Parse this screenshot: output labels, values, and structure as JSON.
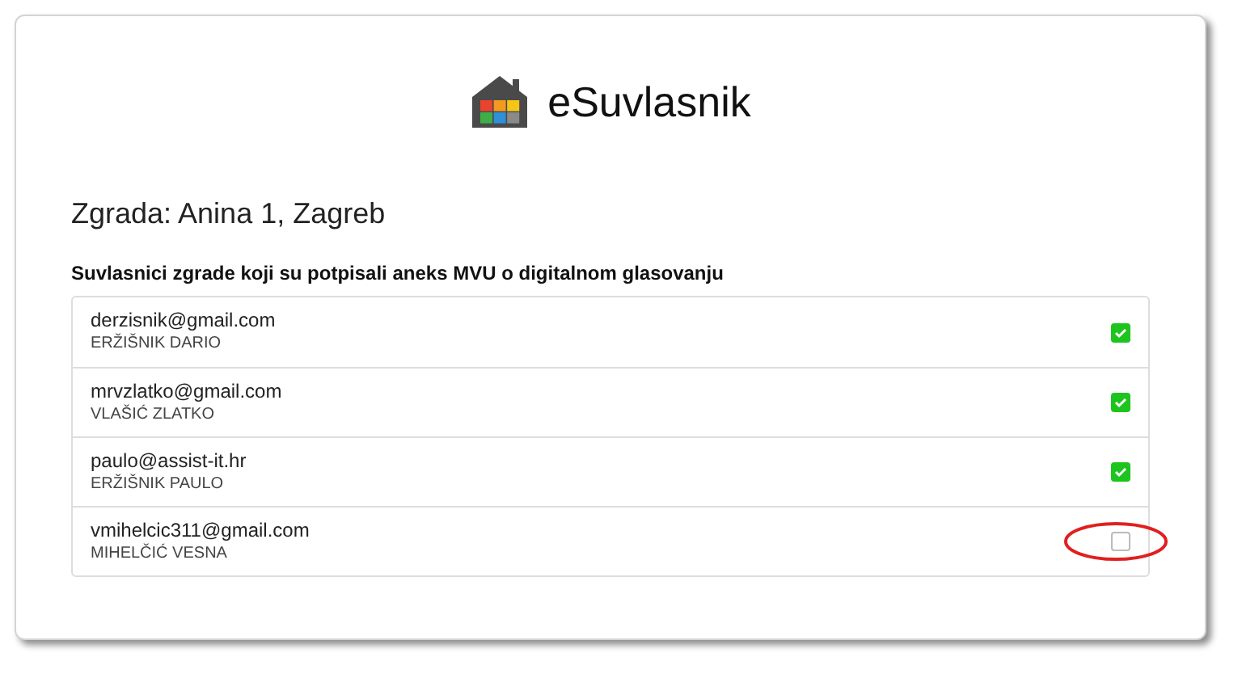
{
  "app": {
    "title": "eSuvlasnik"
  },
  "building": {
    "title": "Zgrada: Anina 1, Zagreb"
  },
  "section": {
    "title": "Suvlasnici zgrade koji su potpisali aneks MVU o digitalnom glasovanju"
  },
  "owners": [
    {
      "email": "derzisnik@gmail.com",
      "name": "ERŽIŠNIK DARIO",
      "checked": true,
      "highlighted": false
    },
    {
      "email": "mrvzlatko@gmail.com",
      "name": "VLAŠIĆ ZLATKO",
      "checked": true,
      "highlighted": false
    },
    {
      "email": "paulo@assist-it.hr",
      "name": "ERŽIŠNIK PAULO",
      "checked": true,
      "highlighted": false
    },
    {
      "email": "vmihelcic311@gmail.com",
      "name": "MIHELČIĆ VESNA",
      "checked": false,
      "highlighted": true
    }
  ]
}
